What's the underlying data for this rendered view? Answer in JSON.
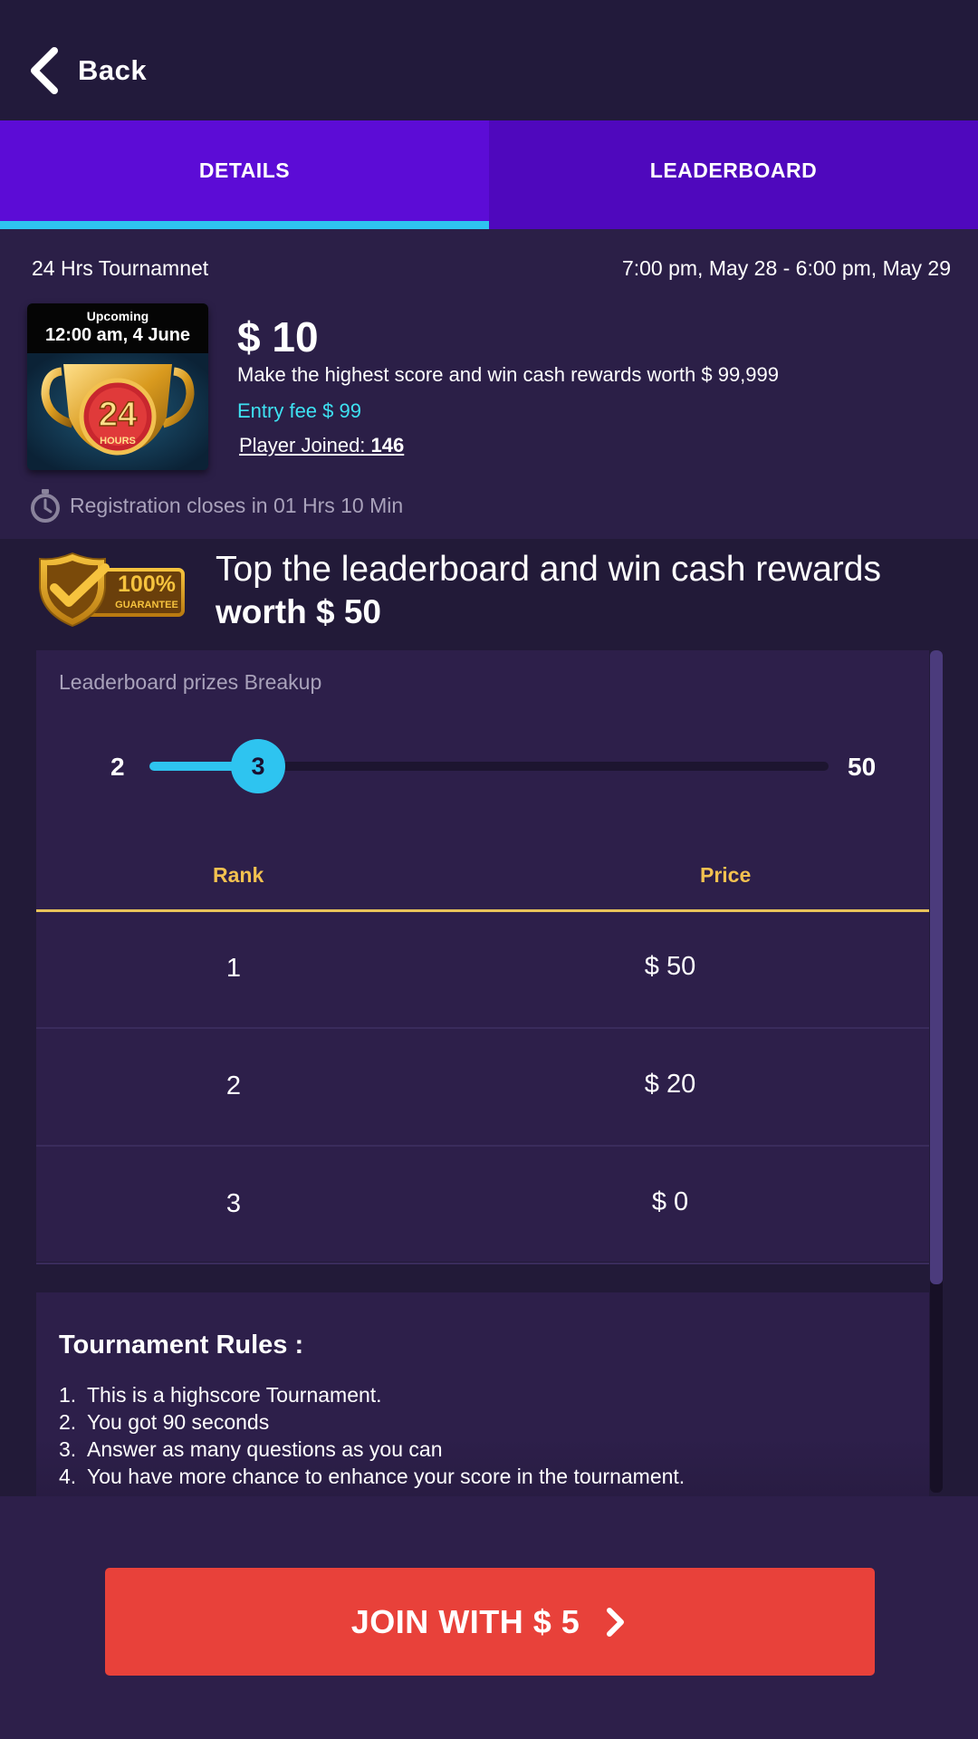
{
  "header": {
    "back_label": "Back"
  },
  "tabs": [
    {
      "label": "DETAILS",
      "active": true
    },
    {
      "label": "LEADERBOARD",
      "active": false
    }
  ],
  "tournament": {
    "name": "24 Hrs Tournamnet",
    "time_range": "7:00 pm, May 28 - 6:00 pm, May 29",
    "card": {
      "status": "Upcoming",
      "date": "12:00 am, 4 June",
      "badge_number": "24",
      "badge_unit": "HOURS"
    },
    "prize": "$ 10",
    "description": "Make the highest score and win cash rewards worth $ 99,999",
    "entry_fee": "Entry fee $ 99",
    "players_label": "Player Joined: ",
    "players_count": "146",
    "registration": "Registration closes in 01 Hrs 10 Min"
  },
  "guarantee": {
    "badge_text": "100%",
    "badge_sub": "GUARANTEE",
    "line1": "Top the leaderboard and win cash rewards",
    "line2": "worth $ 50"
  },
  "prizes": {
    "title": "Leaderboard prizes Breakup",
    "slider": {
      "min": "2",
      "max": "50",
      "value": "3",
      "fill_fraction": 0.16
    },
    "columns": {
      "rank": "Rank",
      "price": "Price"
    },
    "rows": [
      {
        "rank": "1",
        "price": "$ 50"
      },
      {
        "rank": "2",
        "price": "$ 20"
      },
      {
        "rank": "3",
        "price": "$ 0"
      }
    ]
  },
  "rules": {
    "title": "Tournament Rules :",
    "items": [
      {
        "num": "1.",
        "text": "This is a highscore Tournament."
      },
      {
        "num": "2.",
        "text": "You got 90 seconds"
      },
      {
        "num": "3.",
        "text": "Answer as many questions as you can"
      },
      {
        "num": "4.",
        "text": "You have more chance to enhance your score in the tournament."
      }
    ]
  },
  "cta": {
    "label": "JOIN WITH $ 5"
  },
  "colors": {
    "background": "#2b1f47",
    "tab_active": "#5c0cd6",
    "accent_cyan": "#2ec4f0",
    "gold": "#f2c150",
    "cta_red": "#e8413a"
  },
  "icons": {
    "back": "chevron-left-icon",
    "stopwatch": "stopwatch-icon",
    "join_arrow": "chevron-right-icon",
    "guarantee": "shield-check-icon",
    "trophy": "trophy-icon"
  }
}
